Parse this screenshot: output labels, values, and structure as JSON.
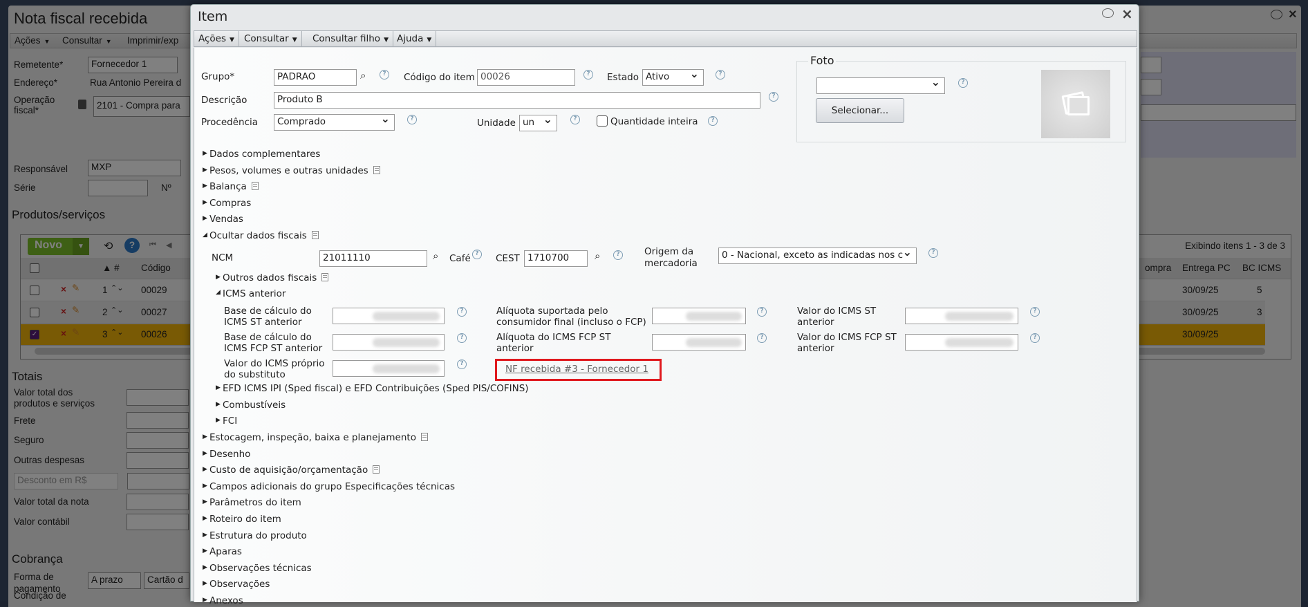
{
  "background_window": {
    "title": "Nota fiscal recebida",
    "menu": [
      "Ações",
      "Consultar",
      "Imprimir/exp"
    ],
    "remetente_label": "Remetente*",
    "remetente_value": "Fornecedor 1",
    "endereco_label": "Endereço*",
    "endereco_value": "Rua Antonio Pereira d",
    "operacao_label_1": "Operação",
    "operacao_label_2": "fiscal*",
    "operacao_value": "2101 - Compra para",
    "responsavel_label": "Responsável",
    "responsavel_value": "MXP",
    "serie_label": "Série",
    "numero_label": "Nº",
    "produtos_title": "Produtos/serviços",
    "novo_label": "Novo",
    "exibindo": "Exibindo itens 1 - 3 de 3",
    "columns": {
      "num": "#",
      "codigo": "Código",
      "compra": "ompra",
      "entrega": "Entrega PC",
      "bc_icms": "BC ICMS"
    },
    "rows": [
      {
        "num": "1",
        "codigo": "00029",
        "entrega": "30/09/25",
        "bc_icms": "5",
        "selected": false
      },
      {
        "num": "2",
        "codigo": "00027",
        "entrega": "30/09/25",
        "bc_icms": "3",
        "selected": false
      },
      {
        "num": "3",
        "codigo": "00026",
        "entrega": "30/09/25",
        "bc_icms": "",
        "selected": true
      }
    ],
    "totais_title": "Totais",
    "totais": {
      "valor_total_1": "Valor total dos",
      "valor_total_2": "produtos e serviços",
      "frete": "Frete",
      "seguro": "Seguro",
      "outras": "Outras despesas",
      "desconto": "Desconto em R$",
      "valor_nota": "Valor total da nota",
      "valor_contabil": "Valor contábil"
    },
    "cobranca_title": "Cobrança",
    "forma_1": "Forma de",
    "forma_2": "pagamento",
    "forma_value": "A prazo",
    "cartao_value": "Cartão d",
    "condicao": "Condição de"
  },
  "modal": {
    "title": "Item",
    "menu": [
      "Ações",
      "Consultar",
      "Consultar filho",
      "Ajuda"
    ],
    "grupo_label": "Grupo*",
    "grupo_value": "PADRAO",
    "codigo_label": "Código do item",
    "codigo_value": "00026",
    "estado_label": "Estado",
    "estado_value": "Ativo",
    "descricao_label": "Descrição",
    "descricao_value": "Produto B",
    "procedencia_label": "Procedência",
    "procedencia_value": "Comprado",
    "unidade_label": "Unidade",
    "unidade_value": "un",
    "quantidade_label": "Quantidade inteira",
    "foto_legend": "Foto",
    "foto_select_value": "",
    "selecionar_label": "Selecionar...",
    "sections_top": [
      {
        "label": "Dados complementares",
        "icon": ""
      },
      {
        "label": "Pesos, volumes e outras unidades",
        "icon": "doc-icon"
      },
      {
        "label": "Balança",
        "icon": "doc-icon"
      },
      {
        "label": "Compras",
        "icon": ""
      },
      {
        "label": "Vendas",
        "icon": ""
      },
      {
        "label": "Ocultar dados fiscais",
        "icon": "doc-icon",
        "expanded": true
      }
    ],
    "ncm_label": "NCM",
    "ncm_value": "21011110",
    "ncm_desc": "Café",
    "cest_label": "CEST",
    "cest_value": "1710700",
    "origem_label_1": "Origem da",
    "origem_label_2": "mercadoria",
    "origem_value": "0 - Nacional, exceto as indicadas nos c",
    "outros_label": "Outros dados fiscais",
    "icms_anterior_label": "ICMS anterior",
    "icms_fields": [
      {
        "l1": "Base de cálculo do",
        "l2": "ICMS ST anterior"
      },
      {
        "l1": "Alíquota suportada pelo",
        "l2": "consumidor final (incluso o FCP)"
      },
      {
        "l1": "Valor do ICMS ST",
        "l2": "anterior"
      },
      {
        "l1": "Base de cálculo do",
        "l2": "ICMS FCP ST anterior"
      },
      {
        "l1": "Alíquota do ICMS FCP ST",
        "l2": "anterior"
      },
      {
        "l1": "Valor do ICMS FCP ST",
        "l2": "anterior"
      },
      {
        "l1": "Valor do ICMS próprio",
        "l2": "do substituto"
      }
    ],
    "nf_link": "NF recebida #3 - Fornecedor 1",
    "highlight_color": "#e0191e",
    "sections_sub": [
      {
        "label": "EFD ICMS IPI (Sped fiscal) e EFD Contribuições (Sped PIS/COFINS)",
        "icon": ""
      },
      {
        "label": "Combustíveis",
        "icon": ""
      },
      {
        "label": "FCI",
        "icon": ""
      }
    ],
    "sections_bottom": [
      {
        "label": "Estocagem, inspeção, baixa e planejamento",
        "icon": "doc-icon"
      },
      {
        "label": "Desenho",
        "icon": ""
      },
      {
        "label": "Custo de aquisição/orçamentação",
        "icon": "doc-icon"
      },
      {
        "label": "Campos adicionais do grupo Especificações técnicas",
        "icon": ""
      },
      {
        "label": "Parâmetros do item",
        "icon": ""
      },
      {
        "label": "Roteiro do item",
        "icon": ""
      },
      {
        "label": "Estrutura do produto",
        "icon": ""
      },
      {
        "label": "Aparas",
        "icon": ""
      },
      {
        "label": "Observações técnicas",
        "icon": ""
      },
      {
        "label": "Observações",
        "icon": ""
      },
      {
        "label": "Anexos",
        "icon": ""
      }
    ]
  }
}
